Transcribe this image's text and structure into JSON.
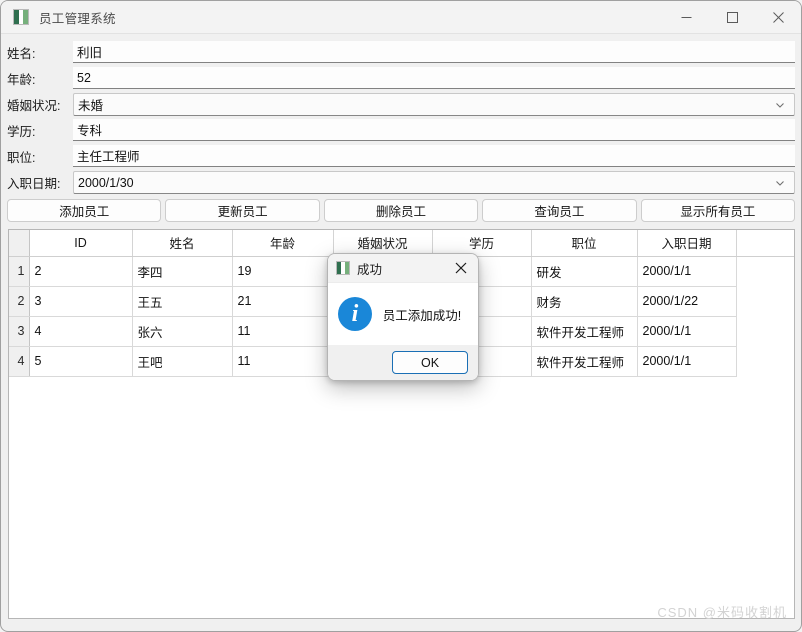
{
  "window": {
    "title": "员工管理系统",
    "icon": "app-icon",
    "controls": {
      "minimize": "minimize-icon",
      "maximize": "maximize-icon",
      "close": "close-icon"
    }
  },
  "form": {
    "fields": [
      {
        "label": "姓名:",
        "value": "利旧",
        "type": "text"
      },
      {
        "label": "年龄:",
        "value": "52",
        "type": "text"
      },
      {
        "label": "婚姻状况:",
        "value": "未婚",
        "type": "combo"
      },
      {
        "label": "学历:",
        "value": "专科",
        "type": "text"
      },
      {
        "label": "职位:",
        "value": "主任工程师",
        "type": "text"
      },
      {
        "label": "入职日期:",
        "value": "2000/1/30",
        "type": "combo"
      }
    ]
  },
  "toolbar": {
    "buttons": [
      {
        "label": "添加员工"
      },
      {
        "label": "更新员工"
      },
      {
        "label": "删除员工"
      },
      {
        "label": "查询员工"
      },
      {
        "label": "显示所有员工"
      }
    ]
  },
  "table": {
    "columns": [
      "ID",
      "姓名",
      "年龄",
      "婚姻状况",
      "学历",
      "职位",
      "入职日期"
    ],
    "rows": [
      {
        "n": "1",
        "cells": [
          "2",
          "李四",
          "19",
          "",
          "",
          "研发",
          "2000/1/1"
        ]
      },
      {
        "n": "2",
        "cells": [
          "3",
          "王五",
          "21",
          "",
          "",
          "财务",
          "2000/1/22"
        ]
      },
      {
        "n": "3",
        "cells": [
          "4",
          "张六",
          "11",
          "",
          "",
          "软件开发工程师",
          "2000/1/1"
        ]
      },
      {
        "n": "4",
        "cells": [
          "5",
          "王吧",
          "11",
          "",
          "",
          "软件开发工程师",
          "2000/1/1"
        ]
      }
    ]
  },
  "watermark": {
    "text": "CSDN @米码收割机"
  },
  "dialog": {
    "title": "成功",
    "icon": "app-icon",
    "close": "close-icon",
    "info_icon": "info-icon",
    "info_glyph": "i",
    "message": "员工添加成功!",
    "ok_label": "OK"
  },
  "colors": {
    "accent": "#1a87d8",
    "focus_border": "#1a6fb5",
    "window_bg": "#f0f0f0",
    "titlebar_bg": "#f3f3f3",
    "grid_line": "#d9d9d9"
  }
}
